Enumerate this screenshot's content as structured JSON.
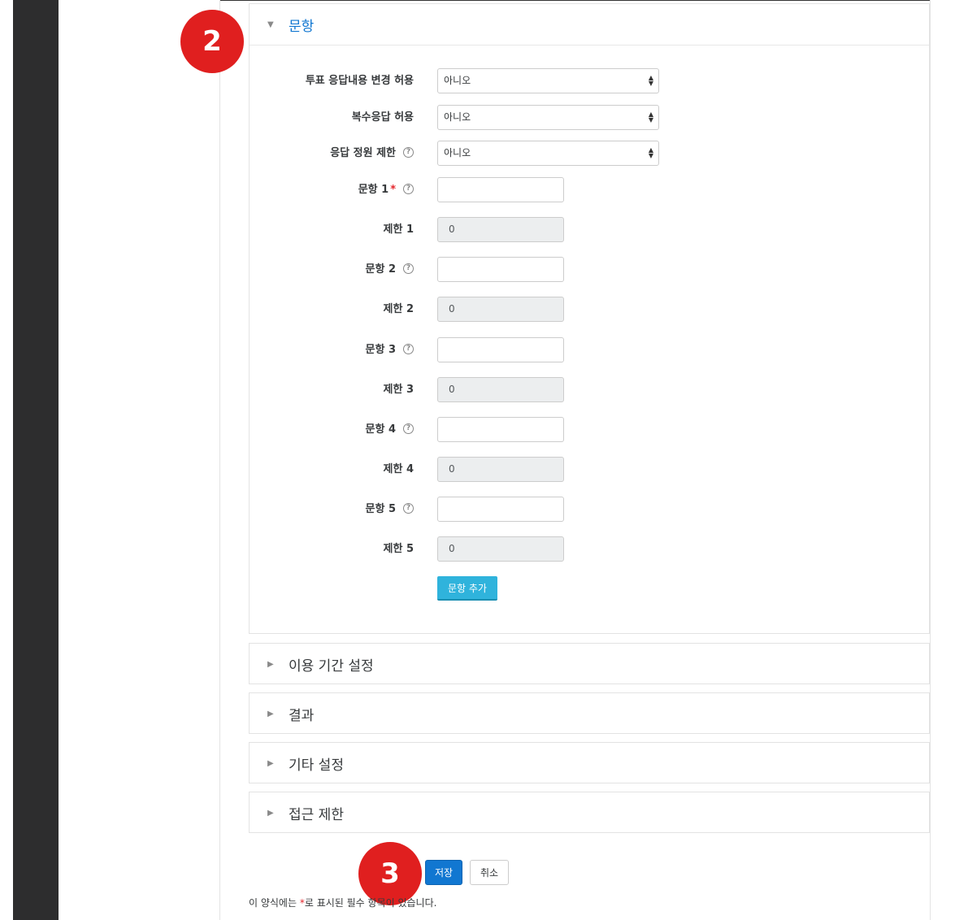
{
  "section_open": {
    "title": "문항",
    "rows": [
      {
        "label": "투표 응답내용 변경 허용",
        "type": "select",
        "value": "아니오",
        "help": false,
        "required": false
      },
      {
        "label": "복수응답 허용",
        "type": "select",
        "value": "아니오",
        "help": false,
        "required": false
      },
      {
        "label": "응답 정원 제한",
        "type": "select",
        "value": "아니오",
        "help": true,
        "required": false
      },
      {
        "label": "문항 1",
        "type": "input",
        "value": "",
        "help": true,
        "required": true
      },
      {
        "label": "제한 1",
        "type": "disabled",
        "value": "0",
        "help": false,
        "required": false
      },
      {
        "label": "문항 2",
        "type": "input",
        "value": "",
        "help": true,
        "required": false
      },
      {
        "label": "제한 2",
        "type": "disabled",
        "value": "0",
        "help": false,
        "required": false
      },
      {
        "label": "문항 3",
        "type": "input",
        "value": "",
        "help": true,
        "required": false
      },
      {
        "label": "제한 3",
        "type": "disabled",
        "value": "0",
        "help": false,
        "required": false
      },
      {
        "label": "문항 4",
        "type": "input",
        "value": "",
        "help": true,
        "required": false
      },
      {
        "label": "제한 4",
        "type": "disabled",
        "value": "0",
        "help": false,
        "required": false
      },
      {
        "label": "문항 5",
        "type": "input",
        "value": "",
        "help": true,
        "required": false
      },
      {
        "label": "제한 5",
        "type": "disabled",
        "value": "0",
        "help": false,
        "required": false
      }
    ],
    "add_button": "문항 추가",
    "help_glyph": "?",
    "required_glyph": "*"
  },
  "collapsed_sections": [
    "이용 기간 설정",
    "결과",
    "기타 설정",
    "접근 제한"
  ],
  "badges": {
    "two": "2",
    "three": "3"
  },
  "buttons": {
    "save": "저장",
    "cancel": "취소"
  },
  "footer_note": {
    "before": "이 양식에는 ",
    "star": "*",
    "after": "로 표시된 필수 항목이 있습니다."
  },
  "colors": {
    "accent": "#1177d1",
    "add_button": "#2fb3dc",
    "badge": "#e01f1f",
    "required": "#e4262c"
  }
}
